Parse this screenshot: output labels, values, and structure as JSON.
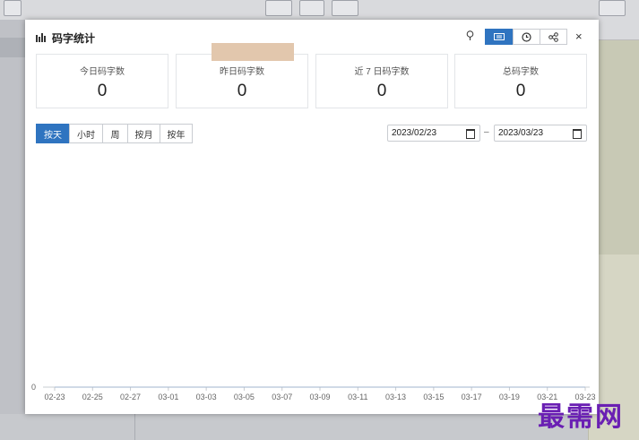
{
  "dialog": {
    "title": "码字统计",
    "close_label": "×"
  },
  "stats": [
    {
      "label": "今日码字数",
      "value": "0"
    },
    {
      "label": "昨日码字数",
      "value": "0"
    },
    {
      "label": "近 7 日码字数",
      "value": "0"
    },
    {
      "label": "总码字数",
      "value": "0"
    }
  ],
  "tabs": [
    "按天",
    "小时",
    "周",
    "按月",
    "按年"
  ],
  "date_range": {
    "start": "2023/02/23",
    "end": "2023/03/23",
    "separator": "–"
  },
  "chart_data": {
    "type": "line",
    "x": [
      "02-23",
      "02-25",
      "02-27",
      "03-01",
      "03-03",
      "03-05",
      "03-07",
      "03-09",
      "03-11",
      "03-13",
      "03-15",
      "03-17",
      "03-19",
      "03-21",
      "03-23"
    ],
    "values": [
      0,
      0,
      0,
      0,
      0,
      0,
      0,
      0,
      0,
      0,
      0,
      0,
      0,
      0,
      0
    ],
    "y_tick_labels": [
      "0"
    ],
    "grid": false
  },
  "watermark": "最需网",
  "colors": {
    "accent": "#2f74c0",
    "watermark": "#6a1fb3"
  }
}
